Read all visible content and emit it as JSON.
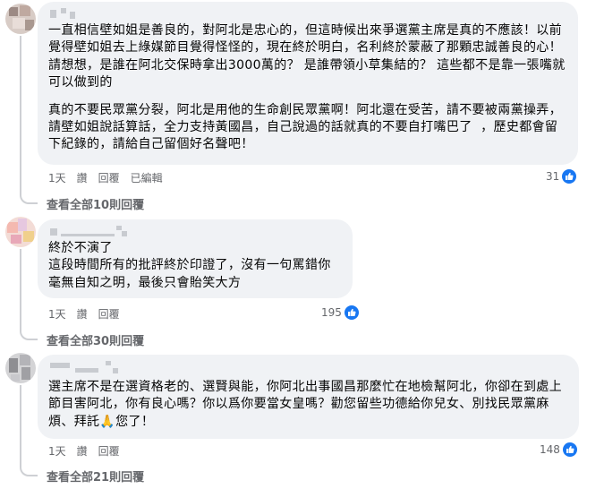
{
  "comments": [
    {
      "paragraphs": [
        "一直相信壁如姐是善良的，對阿北是忠心的，但這時候出來爭選黨主席是真的不應該！以前覺得壁如姐去上綠媒節目覺得怪怪的，現在終於明白，名利終於蒙蔽了那顆忠誠善良的心！ 請想想，是誰在阿北交保時拿出3000萬的？ 是誰帶領小草集結的？ 這些都不是靠一張嘴就可以做到的",
        "真的不要民眾黨分裂，阿北是用他的生命創民眾黨啊！阿北還在受苦，請不要被兩黨操弄，  請壁如姐說話算話，全力支持黃國昌，自己說過的話就真的不要自打嘴巴了  ，歷史都會留下紀錄的，請給自己留個好名聲吧！"
      ],
      "time": "1天",
      "like_label": "讚",
      "reply_label": "回覆",
      "edited_label": "已編輯",
      "reaction_count": "31",
      "view_replies": "查看全部10則回覆"
    },
    {
      "paragraphs": [
        "終於不演了\n這段時間所有的批評終於印證了，沒有一句罵錯你\n毫無自知之明，最後只會貽笑大方"
      ],
      "time": "1天",
      "like_label": "讚",
      "reply_label": "回覆",
      "reaction_count": "195",
      "view_replies": "查看全部30則回覆"
    },
    {
      "paragraphs": [
        "選主席不是在選資格老的、選賢與能，你阿北出事國昌那麼忙在地檢幫阿北，你卻在到處上節目害阿北，你有良心嗎？你以爲你要當女皇嗎？勸您留些功德給你兒女、別找民眾黨麻煩、拜託🙏您了！"
      ],
      "time": "1天",
      "like_label": "讚",
      "reply_label": "回覆",
      "reaction_count": "148",
      "view_replies": "查看全部21則回覆"
    }
  ],
  "colors": {
    "bubble": "#f0f2f5",
    "meta_text": "#65676b",
    "like_blue": "#1877f2",
    "thread_line": "#ced0d4"
  }
}
